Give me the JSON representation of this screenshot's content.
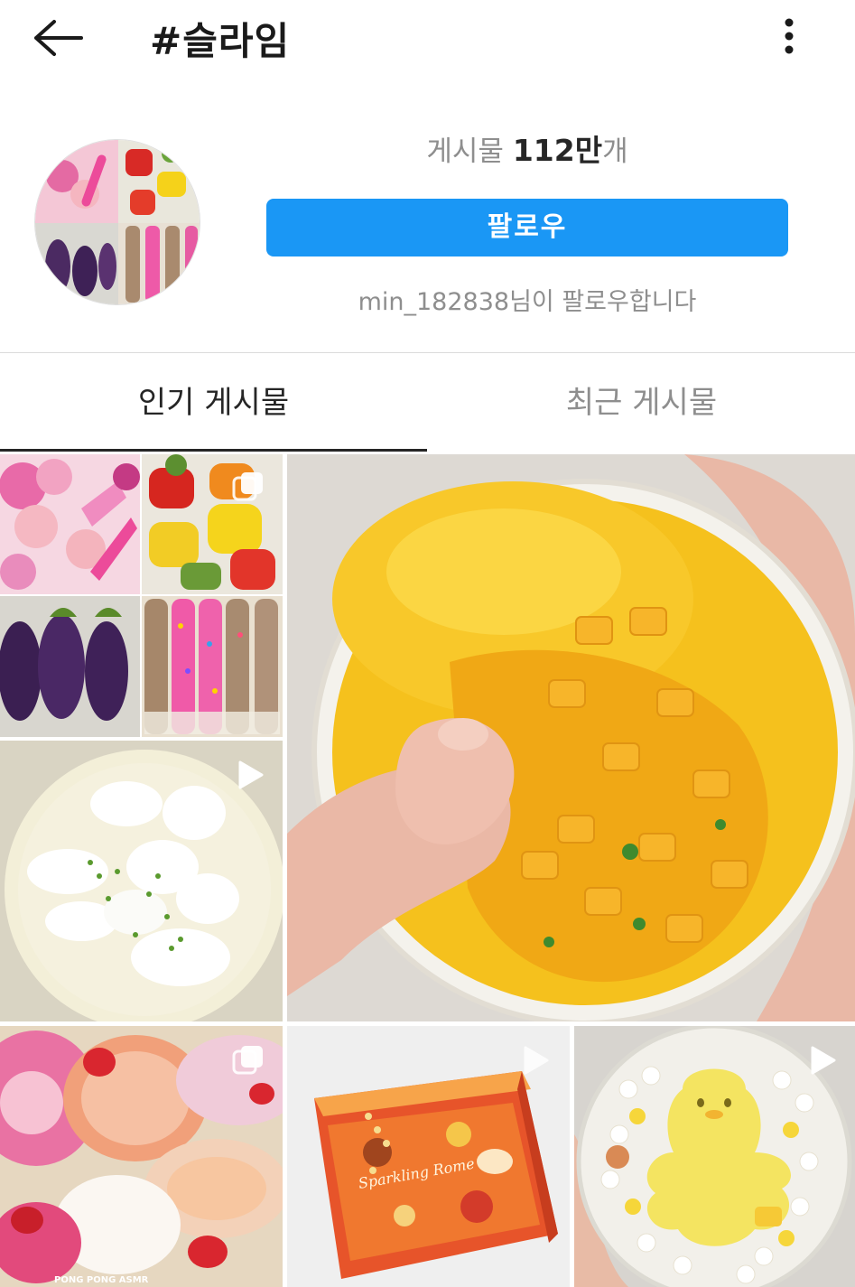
{
  "header": {
    "title": "#슬라임"
  },
  "profile": {
    "post_count_label": "게시물",
    "post_count_value": "112만",
    "post_count_unit": "개",
    "follow_label": "팔로우",
    "followed_by": "min_182838님이 팔로우합니다"
  },
  "tabs": [
    {
      "label": "인기 게시물",
      "active": true
    },
    {
      "label": "최근 게시물",
      "active": false
    }
  ],
  "grid": {
    "items": [
      {
        "name": "collage-post",
        "badge": "multi-image-icon"
      },
      {
        "name": "yellow-slime-featured-post",
        "badge": ""
      },
      {
        "name": "white-cloud-slime-post",
        "badge": "video-play-icon"
      },
      {
        "name": "pink-bread-slime-post",
        "badge": "multi-image-icon"
      },
      {
        "name": "orange-jelly-cube-post",
        "badge": "video-play-icon"
      },
      {
        "name": "yellow-figure-slime-post",
        "badge": "video-play-icon"
      }
    ],
    "watermarks": [
      "PONG PONG ASMR",
      "Sparkling Rome"
    ]
  },
  "colors": {
    "accent": "#1a97f5",
    "text_primary": "#262626",
    "text_secondary": "#8e8e8e"
  }
}
